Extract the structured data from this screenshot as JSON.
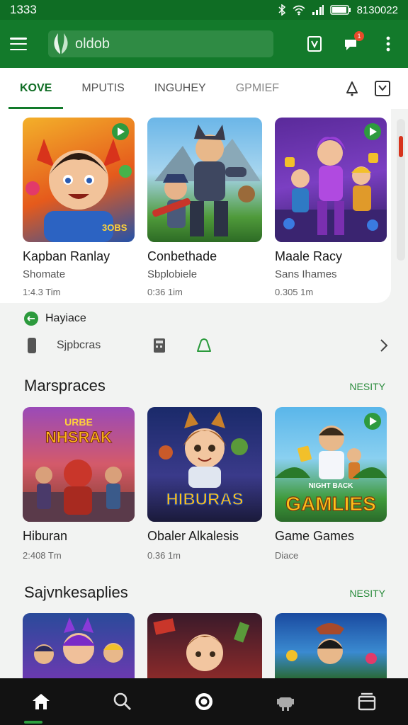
{
  "status_bar": {
    "time": "1333",
    "right_text": "8130022"
  },
  "app_bar": {
    "search_text": "oldob",
    "badge_count": "1"
  },
  "tabs": [
    {
      "label": "KOVE",
      "active": true
    },
    {
      "label": "MPUTIS",
      "active": false
    },
    {
      "label": "INGUHEY",
      "active": false
    },
    {
      "label": "GPMIEF",
      "active": false
    }
  ],
  "featured": [
    {
      "title": "Kapban Ranlay",
      "subtitle": "Shomate",
      "meta": "1:4.3 Tim"
    },
    {
      "title": "Conbethade",
      "subtitle": "Sbplobiele",
      "meta": "0:36 1im"
    },
    {
      "title": "Maale Racy",
      "subtitle": "Sans Ihames",
      "meta": "0.305 1m"
    }
  ],
  "filter": {
    "heading": "Hayiace",
    "dropdown_text": "Sjpbcras"
  },
  "section1": {
    "title": "Marspraces",
    "link": "NESITY",
    "items": [
      {
        "title": "Hiburan",
        "meta": "2:408 Tm",
        "art_text": "NHSRAK",
        "art_top": "URBE"
      },
      {
        "title": "Obaler Alkalesis",
        "meta": "0.36 1m",
        "art_text": "HIBURAS"
      },
      {
        "title": "Game Games",
        "meta": "Diace",
        "art_text": "GAMLIES",
        "art_top": "NIGHT BACK"
      }
    ]
  },
  "section2": {
    "title": "Sajvnkesaplies",
    "link": "NESITY"
  },
  "colors": {
    "primary": "#137a2b",
    "status": "#0f6d24",
    "accent": "#2a8b3c",
    "nav_bg": "#121212"
  },
  "icons": [
    "menu-icon",
    "leaf-logo-icon",
    "checkbox-icon",
    "notification-icon",
    "more-icon",
    "bell-icon",
    "bookmark-icon",
    "home-icon",
    "search-icon",
    "circle-icon",
    "robot-icon",
    "library-icon"
  ]
}
